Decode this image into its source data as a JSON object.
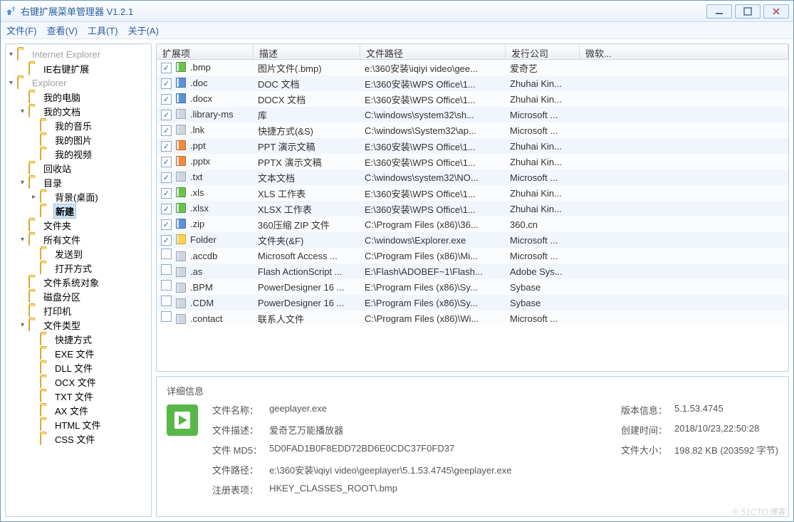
{
  "window": {
    "title": "右键扩展菜单管理器 V1.2.1"
  },
  "menu": {
    "file": "文件(F)",
    "view": "查看(V)",
    "tool": "工具(T)",
    "about": "关于(A)"
  },
  "tree": {
    "root1": {
      "label": "Internet Explorer",
      "child": "IE右键扩展"
    },
    "explorer": "Explorer",
    "mycomputer": "我的电脑",
    "mydocs": "我的文档",
    "mymusic": "我的音乐",
    "mypics": "我的图片",
    "myvideo": "我的视频",
    "recycle": "回收站",
    "dir": "目录",
    "bg": "背景(桌面)",
    "new": "新建",
    "folders": "文件夹",
    "allfiles": "所有文件",
    "sendto": "发送到",
    "openwith": "打开方式",
    "fsobj": "文件系统对象",
    "disk": "磁盘分区",
    "printer": "打印机",
    "filetype": "文件类型",
    "shortcut": "快捷方式",
    "exe": "EXE 文件",
    "dll": "DLL 文件",
    "ocx": "OCX 文件",
    "txt": "TXT 文件",
    "ax": "AX 文件",
    "html": "HTML 文件",
    "css": "CSS 文件"
  },
  "columns": {
    "ext": "扩展项",
    "desc": "描述",
    "path": "文件路径",
    "pub": "发行公司",
    "ms": "微软..."
  },
  "rows": [
    {
      "checked": true,
      "ico": "green",
      "ext": ".bmp",
      "desc": "图片文件(.bmp)",
      "path": "e:\\360安装\\iqiyi video\\gee...",
      "pub": "爱奇艺"
    },
    {
      "checked": true,
      "ico": "blue",
      "ext": ".doc",
      "desc": "DOC 文档",
      "path": "E:\\360安装\\WPS Office\\1...",
      "pub": "Zhuhai Kin..."
    },
    {
      "checked": true,
      "ico": "blue",
      "ext": ".docx",
      "desc": "DOCX 文档",
      "path": "E:\\360安装\\WPS Office\\1...",
      "pub": "Zhuhai Kin..."
    },
    {
      "checked": true,
      "ico": "gray",
      "ext": ".library-ms",
      "desc": "库",
      "path": "C:\\windows\\system32\\sh...",
      "pub": "Microsoft ..."
    },
    {
      "checked": true,
      "ico": "gray",
      "ext": ".lnk",
      "desc": "快捷方式(&S)",
      "path": "C:\\windows\\System32\\ap...",
      "pub": "Microsoft ..."
    },
    {
      "checked": true,
      "ico": "orange",
      "ext": ".ppt",
      "desc": "PPT 演示文稿",
      "path": "E:\\360安装\\WPS Office\\1...",
      "pub": "Zhuhai Kin..."
    },
    {
      "checked": true,
      "ico": "orange",
      "ext": ".pptx",
      "desc": "PPTX 演示文稿",
      "path": "E:\\360安装\\WPS Office\\1...",
      "pub": "Zhuhai Kin..."
    },
    {
      "checked": true,
      "ico": "gray",
      "ext": ".txt",
      "desc": "文本文档",
      "path": "C:\\windows\\system32\\NO...",
      "pub": "Microsoft ..."
    },
    {
      "checked": true,
      "ico": "green",
      "ext": ".xls",
      "desc": "XLS 工作表",
      "path": "E:\\360安装\\WPS Office\\1...",
      "pub": "Zhuhai Kin..."
    },
    {
      "checked": true,
      "ico": "green",
      "ext": ".xlsx",
      "desc": "XLSX 工作表",
      "path": "E:\\360安装\\WPS Office\\1...",
      "pub": "Zhuhai Kin..."
    },
    {
      "checked": true,
      "ico": "blue",
      "ext": ".zip",
      "desc": "360压缩 ZIP 文件",
      "path": "C:\\Program Files (x86)\\36...",
      "pub": "360.cn"
    },
    {
      "checked": true,
      "ico": "yellow",
      "ext": "Folder",
      "desc": "文件夹(&F)",
      "path": "C:\\windows\\Explorer.exe",
      "pub": "Microsoft ..."
    },
    {
      "checked": false,
      "ico": "gray",
      "ext": ".accdb",
      "desc": "Microsoft Access ...",
      "path": "C:\\Program Files (x86)\\Mi...",
      "pub": "Microsoft ..."
    },
    {
      "checked": false,
      "ico": "gray",
      "ext": ".as",
      "desc": "Flash ActionScript ...",
      "path": "E:\\Flash\\ADOBEF~1\\Flash...",
      "pub": "Adobe Sys..."
    },
    {
      "checked": false,
      "ico": "gray",
      "ext": ".BPM",
      "desc": "PowerDesigner 16 ...",
      "path": "E:\\Program Files (x86)\\Sy...",
      "pub": "Sybase"
    },
    {
      "checked": false,
      "ico": "gray",
      "ext": ".CDM",
      "desc": "PowerDesigner 16 ...",
      "path": "E:\\Program Files (x86)\\Sy...",
      "pub": "Sybase"
    },
    {
      "checked": false,
      "ico": "gray",
      "ext": ".contact",
      "desc": "联系人文件",
      "path": "C:\\Program Files (x86)\\Wi...",
      "pub": "Microsoft ..."
    }
  ],
  "detail": {
    "title": "详细信息",
    "labels": {
      "name": "文件名称：",
      "desc": "文件描述：",
      "md5": "文件 MD5：",
      "path": "文件路径：",
      "reg": "注册表项：",
      "ver": "版本信息：",
      "ctime": "创建时间：",
      "size": "文件大小："
    },
    "values": {
      "name": "geeplayer.exe",
      "desc": "爱奇艺万能播放器",
      "md5": "5D0FAD1B0F8EDD72BD6E0CDC37F0FD37",
      "path": "e:\\360安装\\iqiyi video\\geeplayer\\5.1.53.4745\\geeplayer.exe",
      "reg": "HKEY_CLASSES_ROOT\\.bmp",
      "ver": "5.1.53.4745",
      "ctime": "2018/10/23,22:50:28",
      "size": "198.82 KB (203592 字节)"
    }
  },
  "watermark": "© 51CTO博客"
}
